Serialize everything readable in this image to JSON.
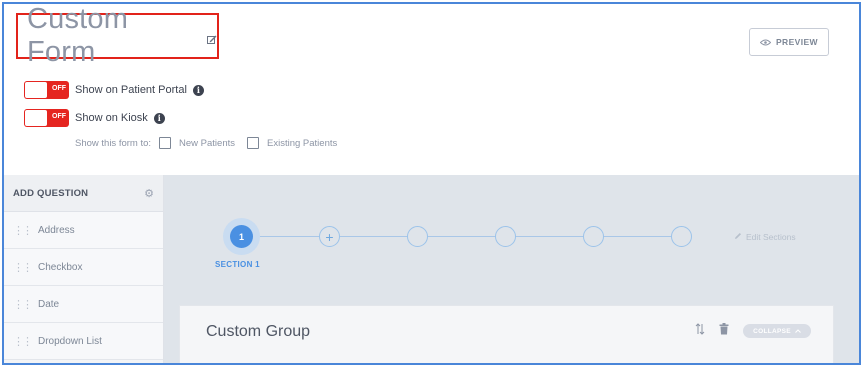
{
  "header": {
    "title": "Custom Form",
    "preview_label": "PREVIEW"
  },
  "toggles": [
    {
      "label": "Show on Patient Portal",
      "state": "OFF"
    },
    {
      "label": "Show on Kiosk",
      "state": "OFF"
    }
  ],
  "show_to": {
    "label": "Show this form to:",
    "options": [
      "New Patients",
      "Existing Patients"
    ]
  },
  "sidebar": {
    "title": "ADD QUESTION",
    "items": [
      "Address",
      "Checkbox",
      "Date",
      "Dropdown List"
    ]
  },
  "sections": {
    "active_number": "1",
    "active_label": "SECTION 1",
    "add_symbol": "+",
    "edit_label": "Edit Sections"
  },
  "group": {
    "title": "Custom Group",
    "collapse_label": "COLLAPSE"
  },
  "colors": {
    "frame_border": "#4a86d9",
    "title_highlight": "#e2231a",
    "toggle_off": "#e52520",
    "accent": "#4a90e2"
  }
}
